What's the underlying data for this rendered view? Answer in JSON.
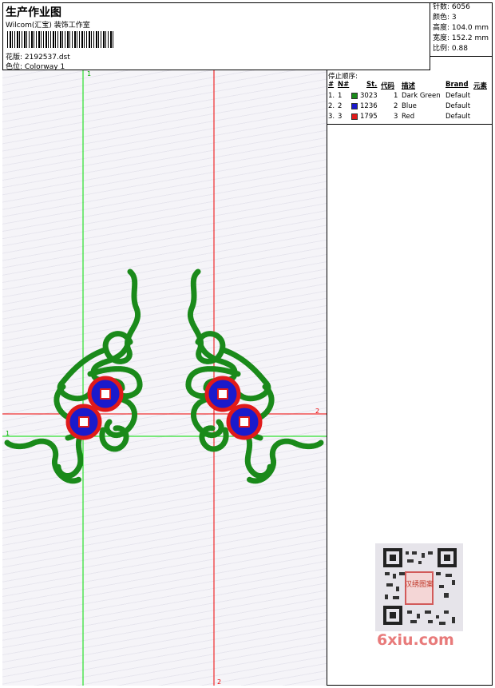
{
  "header": {
    "title": "生产作业图",
    "company": "Wilcom(汇宝) 装饰工作室",
    "design_label": "花版: 2192537.dst",
    "colorway_label": "色位: Colorway 1"
  },
  "stats": [
    "针数: 6056",
    "颜色: 3",
    "高度: 104.0 mm",
    "宽度: 152.2 mm",
    "比例: 0.88"
  ],
  "stop_sequence": {
    "title": "停止顺序:",
    "headers": [
      "#",
      "N#",
      "St.",
      "代码",
      "描述",
      "Brand",
      "元素"
    ],
    "rows": [
      {
        "num": "1.",
        "n": "1",
        "stitch": "3023",
        "code": "1",
        "desc": "Dark Green",
        "brand": "Default",
        "color": "#1a8a1a"
      },
      {
        "num": "2.",
        "n": "2",
        "stitch": "1236",
        "code": "2",
        "desc": "Blue",
        "brand": "Default",
        "color": "#1a1acc"
      },
      {
        "num": "3.",
        "n": "3",
        "stitch": "1795",
        "code": "3",
        "desc": "Red",
        "brand": "Default",
        "color": "#e01a1a"
      }
    ]
  },
  "guides": {
    "green_label": "1",
    "red_label": "2"
  },
  "watermark": {
    "qr_text": "汉绣图案",
    "logo": "6xiu.com"
  },
  "colors": {
    "green_thread": "#1a8a1a",
    "blue_thread": "#1a1acc",
    "red_thread": "#e01a1a",
    "green_guide": "#00dd00",
    "red_guide": "#ee0000"
  }
}
